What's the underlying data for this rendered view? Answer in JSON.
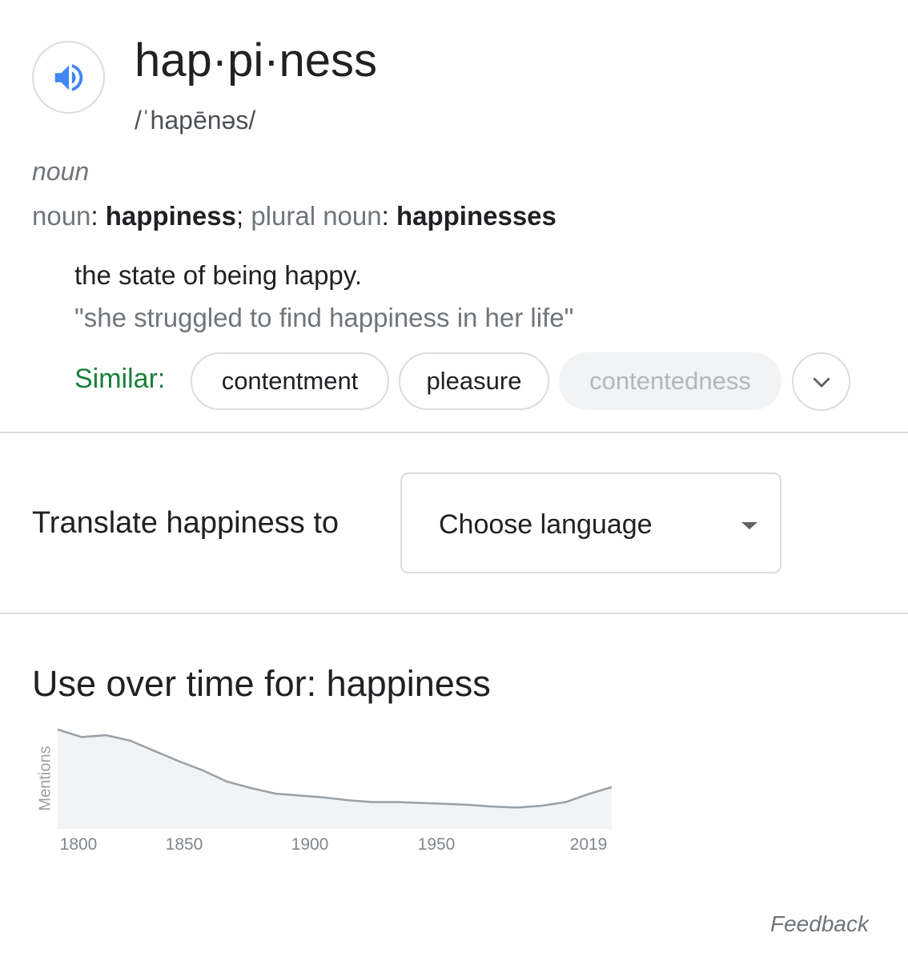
{
  "entry": {
    "word": "hap·pi·ness",
    "phonetic": "/ˈhapēnəs/",
    "part_of_speech": "noun",
    "forms": {
      "label1": "noun",
      "form1": "happiness",
      "label2": "plural noun",
      "form2": "happinesses"
    },
    "definition": "the state of being happy.",
    "example": "\"she struggled to find happiness in her life\"",
    "similar": {
      "label": "Similar:",
      "chips": [
        "contentment",
        "pleasure",
        "contentedness"
      ]
    }
  },
  "translate": {
    "label": "Translate happiness to",
    "select_value": "Choose language"
  },
  "usage": {
    "title": "Use over time for: happiness",
    "chart_data": {
      "type": "area",
      "ylabel": "Mentions",
      "x_ticks": [
        "1800",
        "1850",
        "1900",
        "1950",
        "2019"
      ],
      "x": [
        1790,
        1800,
        1810,
        1820,
        1830,
        1840,
        1850,
        1860,
        1870,
        1880,
        1890,
        1900,
        1910,
        1920,
        1930,
        1940,
        1950,
        1960,
        1970,
        1980,
        1990,
        2000,
        2010,
        2019
      ],
      "values": [
        100,
        92,
        94,
        88,
        77,
        66,
        56,
        44,
        37,
        31,
        29,
        27,
        24,
        22,
        22,
        21,
        20,
        19,
        17,
        16,
        18,
        22,
        31,
        38
      ],
      "fill_color": "#f1f3f4",
      "line_color": "#9aa0a6"
    }
  },
  "footer": {
    "feedback": "Feedback"
  },
  "colors": {
    "similar_label": "#188038",
    "speaker_icon": "#4285f4"
  },
  "icons": {
    "speaker": "speaker-volume-icon",
    "expand": "chevron-down-icon",
    "dropdown": "caret-down-icon"
  }
}
